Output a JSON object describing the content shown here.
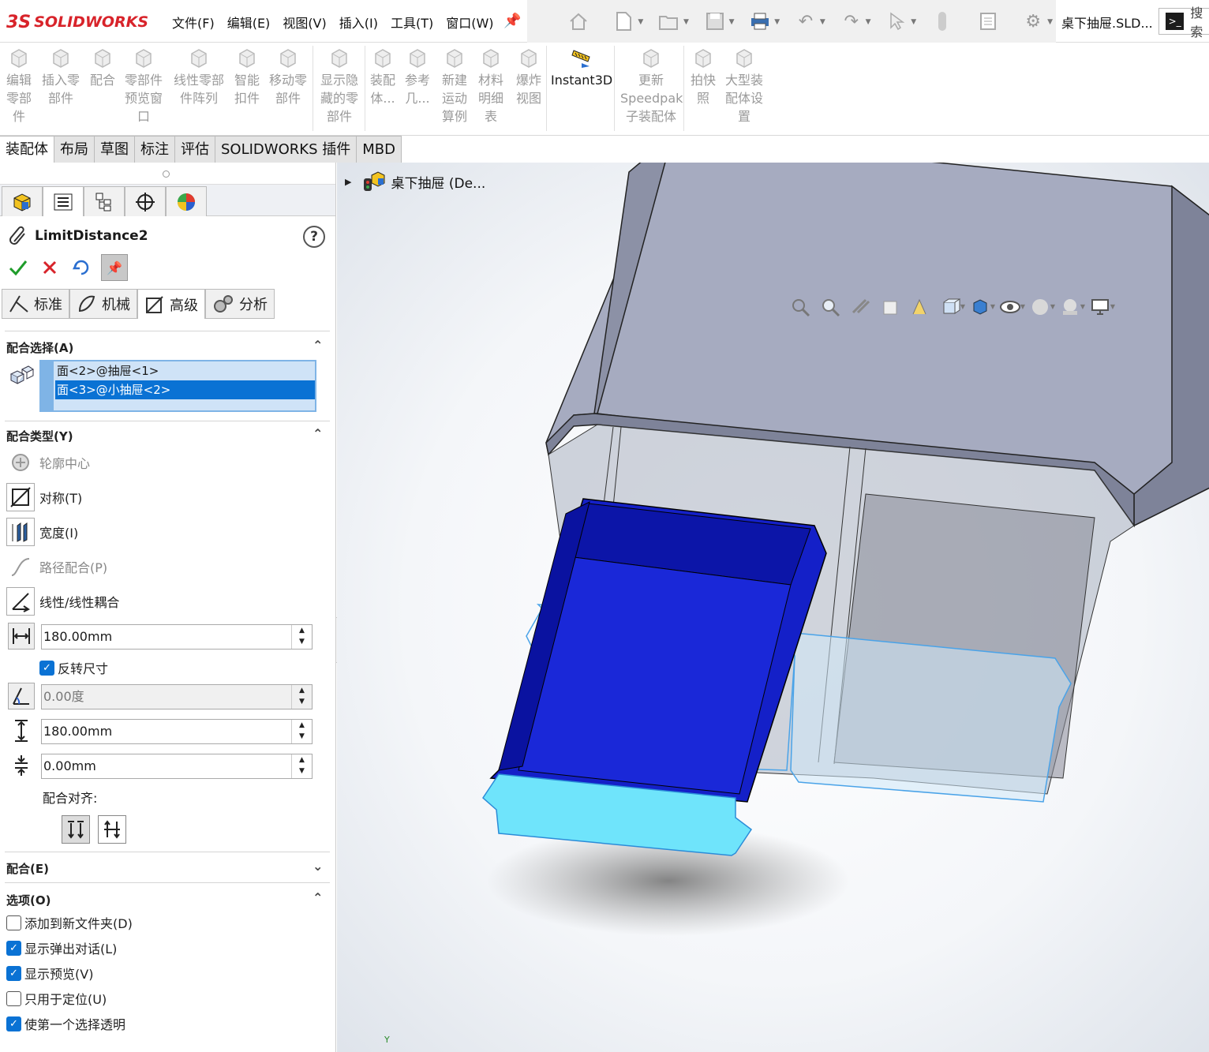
{
  "app": {
    "brand_prefix": "3S",
    "brand": "SOLIDWORKS",
    "document_title": "桌下抽屉.SLD...",
    "search_label": "搜索",
    "terminal_glyph": ">_"
  },
  "menu": {
    "items": [
      "文件(F)",
      "编辑(E)",
      "视图(V)",
      "插入(I)",
      "工具(T)",
      "窗口(W)"
    ]
  },
  "quick_access": [
    "home-icon",
    "new-doc-icon",
    "open-icon",
    "save-icon",
    "print-icon",
    "undo-icon",
    "redo-icon",
    "select-icon",
    "rebuild-icon",
    "file-props-icon",
    "options-icon"
  ],
  "command_manager": {
    "buttons": [
      {
        "name": "edit-component",
        "label": "编辑\n零部\n件",
        "active": false
      },
      {
        "name": "insert-components",
        "label": "插入零\n部件",
        "active": false
      },
      {
        "name": "mate",
        "label": "配合",
        "active": false
      },
      {
        "name": "component-preview",
        "label": "零部件\n预览窗\n口",
        "active": false
      },
      {
        "name": "linear-pattern",
        "label": "线性零部\n件阵列",
        "active": false
      },
      {
        "name": "smart-fasteners",
        "label": "智能\n扣件",
        "active": false
      },
      {
        "name": "move-component",
        "label": "移动零\n部件",
        "active": false
      },
      {
        "name": "show-hidden",
        "label": "显示隐\n藏的零\n部件",
        "active": false
      },
      {
        "name": "assembly-features",
        "label": "装配\n体...",
        "active": false
      },
      {
        "name": "reference-geometry",
        "label": "参考\n几...",
        "active": false
      },
      {
        "name": "new-motion-study",
        "label": "新建\n运动\n算例",
        "active": false
      },
      {
        "name": "bill-of-materials",
        "label": "材料\n明细\n表",
        "active": false
      },
      {
        "name": "exploded-view",
        "label": "爆炸\n视图",
        "active": false
      },
      {
        "name": "instant3d",
        "label": "Instant3D",
        "active": true
      },
      {
        "name": "update-speedpak",
        "label": "更新\nSpeedpak\n子装配体",
        "active": false
      },
      {
        "name": "take-snapshot",
        "label": "拍快\n照",
        "active": false
      },
      {
        "name": "large-assembly",
        "label": "大型装\n配体设\n置",
        "active": false
      }
    ]
  },
  "tabs": [
    {
      "label": "装配体",
      "selected": true
    },
    {
      "label": "布局",
      "selected": false
    },
    {
      "label": "草图",
      "selected": false
    },
    {
      "label": "标注",
      "selected": false
    },
    {
      "label": "评估",
      "selected": false
    },
    {
      "label": "SOLIDWORKS 插件",
      "selected": false
    },
    {
      "label": "MBD",
      "selected": false
    }
  ],
  "property_manager": {
    "title": "LimitDistance2",
    "help": "?",
    "subtabs": [
      "标准",
      "机械",
      "高级",
      "分析"
    ],
    "selected_subtab": "高级",
    "mate_selection": {
      "header": "配合选择(A)",
      "items": [
        "面<2>@抽屉<1>",
        "面<3>@小抽屉<2>"
      ],
      "highlighted_index": 1
    },
    "mate_types": {
      "header": "配合类型(Y)",
      "items": [
        {
          "label": "轮廓中心",
          "enabled": false
        },
        {
          "label": "对称(T)",
          "enabled": true
        },
        {
          "label": "宽度(I)",
          "enabled": true
        },
        {
          "label": "路径配合(P)",
          "enabled": false
        },
        {
          "label": "线性/线性耦合",
          "enabled": true
        }
      ]
    },
    "distance": {
      "value": "180.00mm",
      "flip_label": "反转尺寸",
      "flip_checked": true
    },
    "angle": {
      "value": "0.00度",
      "enabled": false
    },
    "max_distance": {
      "value": "180.00mm"
    },
    "min_distance": {
      "value": "0.00mm"
    },
    "alignment_label": "配合对齐:",
    "mates_header": "配合(E)",
    "options": {
      "header": "选项(O)",
      "items": [
        {
          "label": "添加到新文件夹(D)",
          "checked": false
        },
        {
          "label": "显示弹出对话(L)",
          "checked": true
        },
        {
          "label": "显示预览(V)",
          "checked": true
        },
        {
          "label": "只用于定位(U)",
          "checked": false
        },
        {
          "label": "使第一个选择透明",
          "checked": true
        }
      ]
    }
  },
  "feature_tree": {
    "root_label": "桌下抽屉 (De..."
  },
  "heads_up_toolbar": [
    "zoom-to-fit-icon",
    "zoom-area-icon",
    "previous-view-icon",
    "section-view-icon",
    "dynamic-annotation-icon",
    "view-orientation-icon",
    "display-style-icon",
    "hide-show-icon",
    "edit-appearance-icon",
    "apply-scene-icon",
    "view-settings-icon"
  ],
  "triad": {
    "y_label": "Y"
  },
  "colors": {
    "brand": "#d8232a",
    "selection": "#0a72d4",
    "housing": "#a6abc0",
    "drawer": "#1420c8",
    "drawer_front": "#6fe4fb",
    "preview_outline": "#4aa3e8"
  }
}
